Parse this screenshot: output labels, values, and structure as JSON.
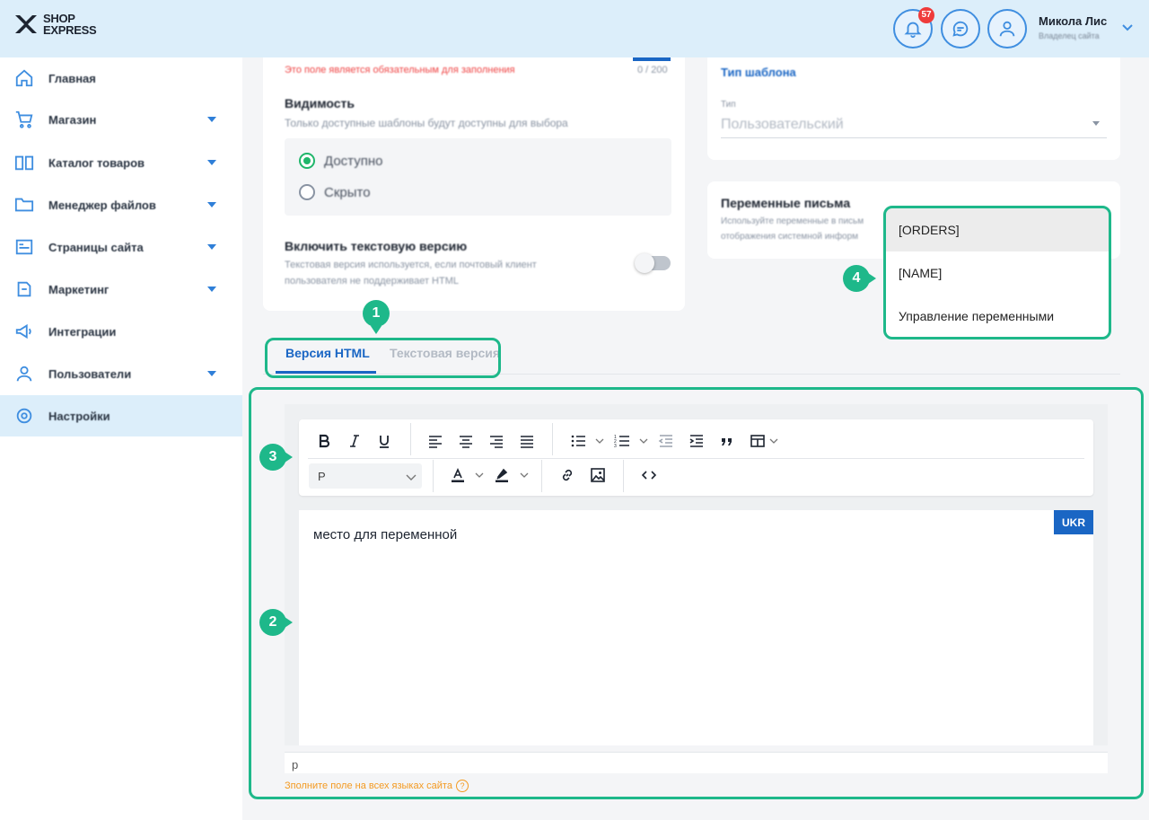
{
  "header": {
    "logo_line1": "SHOP",
    "logo_line2": "EXPRESS",
    "notifications_count": "57",
    "user_name": "Микола Лис",
    "user_role": "Владелец сайта"
  },
  "sidebar": {
    "items": [
      {
        "label": "Главная",
        "icon": "home-icon",
        "has_submenu": false
      },
      {
        "label": "Магазин",
        "icon": "cart-icon",
        "has_submenu": true
      },
      {
        "label": "Каталог товаров",
        "icon": "book-icon",
        "has_submenu": true
      },
      {
        "label": "Менеджер файлов",
        "icon": "folder-icon",
        "has_submenu": true
      },
      {
        "label": "Страницы сайта",
        "icon": "pages-icon",
        "has_submenu": true
      },
      {
        "label": "Маркетинг",
        "icon": "marketing-icon",
        "has_submenu": true
      },
      {
        "label": "Интеграции",
        "icon": "megaphone-icon",
        "has_submenu": false
      },
      {
        "label": "Пользователи",
        "icon": "users-icon",
        "has_submenu": true
      },
      {
        "label": "Настройки",
        "icon": "settings-icon",
        "has_submenu": false,
        "active": true
      }
    ]
  },
  "form": {
    "required_error": "Это поле является обязательным для заполнения",
    "char_counter": "0 / 200",
    "visibility_title": "Видимость",
    "visibility_hint": "Только доступные шаблоны будут доступны для выбора",
    "visibility_options": [
      "Доступно",
      "Скрыто"
    ],
    "visibility_selected": "Доступно",
    "text_version_title": "Включить текстовую версию",
    "text_version_hint_line1": "Текстовая версия используется, если почтовый клиент",
    "text_version_hint_line2": "пользователя не поддерживает HTML",
    "text_version_enabled": false
  },
  "template_type": {
    "title": "Тип шаблона",
    "field_label": "Тип",
    "field_value": "Пользовательский"
  },
  "variables": {
    "title": "Переменные письма",
    "hint_line1": "Используйте переменные в письм",
    "hint_line2": "отображения системной информ",
    "dropdown_items": [
      "[ORDERS]",
      "[NAME]",
      "Управление переменными"
    ],
    "highlighted_item": "[ORDERS]"
  },
  "tabs": {
    "html": "Версия HTML",
    "text": "Текстовая версия",
    "active": "html"
  },
  "editor": {
    "block_format": "P",
    "content": "место для переменной",
    "language_badge": "UKR",
    "status_path": "p",
    "hint": "Зполните поле на всех языках сайта",
    "help_symbol": "?"
  },
  "markers": [
    "1",
    "2",
    "3",
    "4"
  ],
  "colors": {
    "accent": "#1eb88a",
    "primary": "#1a66c4",
    "header_bg": "#dceefa",
    "error": "#ef4444",
    "warning": "#f39a21"
  }
}
